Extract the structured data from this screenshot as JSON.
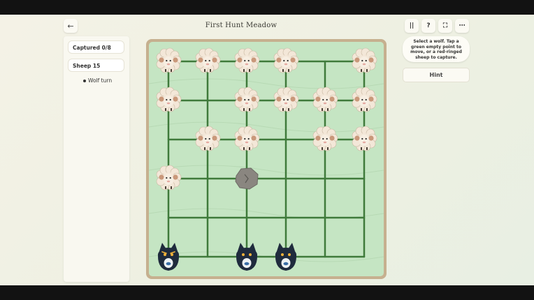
{
  "header": {
    "title": "First Hunt Meadow",
    "back_icon": "←",
    "pause_icon": "||",
    "help_icon": "?",
    "fullscreen_icon": "⛶",
    "more_icon": "⋯"
  },
  "stats": {
    "captured": "Captured 0/8",
    "sheep": "Sheep 15",
    "turn": "Wolf turn"
  },
  "instructions": "Select a wolf. Tap a green empty point to move, or a red-ringed sheep to capture.",
  "hint_label": "Hint",
  "board": {
    "columns": 6,
    "rows": 6,
    "sheep": [
      [
        0,
        0
      ],
      [
        1,
        0
      ],
      [
        2,
        0
      ],
      [
        3,
        0
      ],
      [
        5,
        0
      ],
      [
        0,
        1
      ],
      [
        2,
        1
      ],
      [
        3,
        1
      ],
      [
        4,
        1
      ],
      [
        5,
        1
      ],
      [
        1,
        2
      ],
      [
        2,
        2
      ],
      [
        4,
        2
      ],
      [
        5,
        2
      ],
      [
        0,
        3
      ]
    ],
    "wolves": [
      [
        0,
        5
      ],
      [
        2,
        5
      ],
      [
        3,
        5
      ]
    ],
    "rock": [
      2,
      3
    ],
    "colors": {
      "board": "#c5e5c3",
      "lines": "#3f7a3b",
      "frame": "#c6b08f",
      "wolf": "#1f2b3d",
      "sheep": "#f3e7d8",
      "rock": "#8a8680"
    }
  }
}
